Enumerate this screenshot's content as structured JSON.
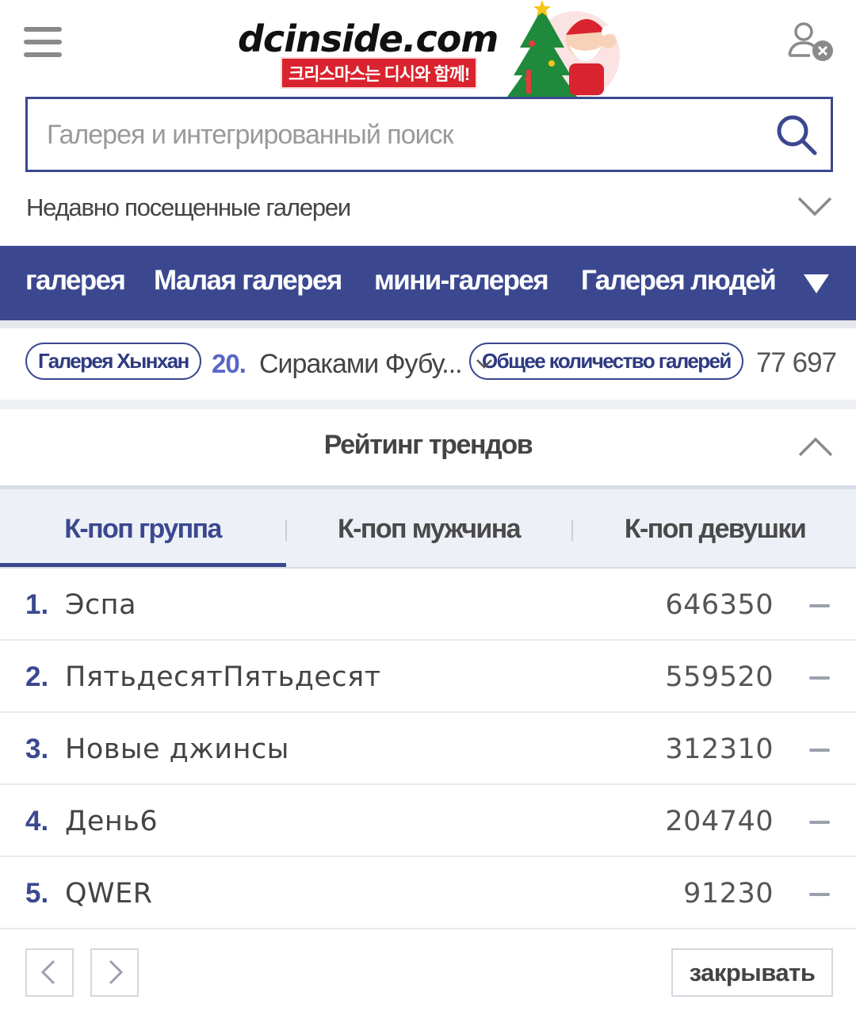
{
  "header": {
    "logo_text": "dcinside.com",
    "logo_subtitle": "크리스마스는 디시와 함께!",
    "menu_icon": "hamburger-menu-icon",
    "user_icon": "user-logout-icon"
  },
  "search": {
    "placeholder": "Галерея и интегрированный поиск",
    "icon": "search-icon"
  },
  "recent": {
    "label": "Недавно посещенные галереи",
    "icon": "chevron-down-icon"
  },
  "nav": {
    "items": [
      "галерея",
      "Малая галерея",
      "мини-галерея",
      "Галерея людей"
    ],
    "dropdown_icon": "triangle-down-icon"
  },
  "info": {
    "gallery_pill": "Галерея Хынхан",
    "rank_number": "20.",
    "rank_name": "Сираками Фубу...",
    "total_pill": "Общее количество галерей",
    "total_count": "77 697"
  },
  "trending": {
    "title": "Рейтинг трендов",
    "collapse_icon": "chevron-up-icon",
    "tabs": [
      "К-поп группа",
      "К-поп мужчина",
      "К-поп девушки"
    ],
    "active_tab": 0,
    "rows": [
      {
        "num": "1.",
        "name": "Эспа",
        "value": "646350"
      },
      {
        "num": "2.",
        "name": "ПятьдесятПятьдесят",
        "value": "559520"
      },
      {
        "num": "3.",
        "name": "Новые джинсы",
        "value": "312310"
      },
      {
        "num": "4.",
        "name": "День6",
        "value": "204740"
      },
      {
        "num": "5.",
        "name": "QWER",
        "value": "91230"
      }
    ]
  },
  "footer": {
    "prev_icon": "chevron-left-icon",
    "next_icon": "chevron-right-icon",
    "close_label": "закрывать"
  },
  "colors": {
    "primary": "#3b4890",
    "accent_red": "#d9232e",
    "rank_blue": "#5966c6"
  }
}
